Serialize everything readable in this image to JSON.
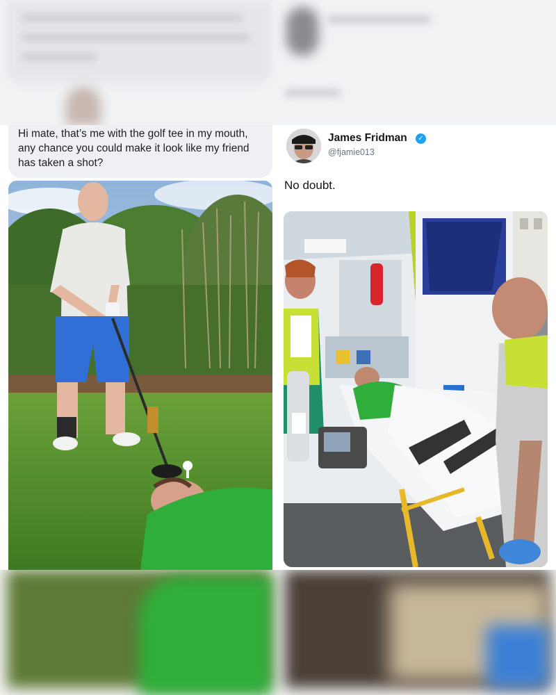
{
  "request": {
    "message": "Hi mate, that’s me with the golf tee in my mouth, any chance you could make it look like my friend has taken a shot?"
  },
  "tweet": {
    "display_name": "James Fridman",
    "handle": "@fjamie013",
    "verified_icon": "verified-badge-icon",
    "text": "No doubt."
  },
  "colors": {
    "bubble_bg": "#eef0f3",
    "verified_blue": "#1da1f2",
    "shirt_green": "#2fae3c"
  }
}
